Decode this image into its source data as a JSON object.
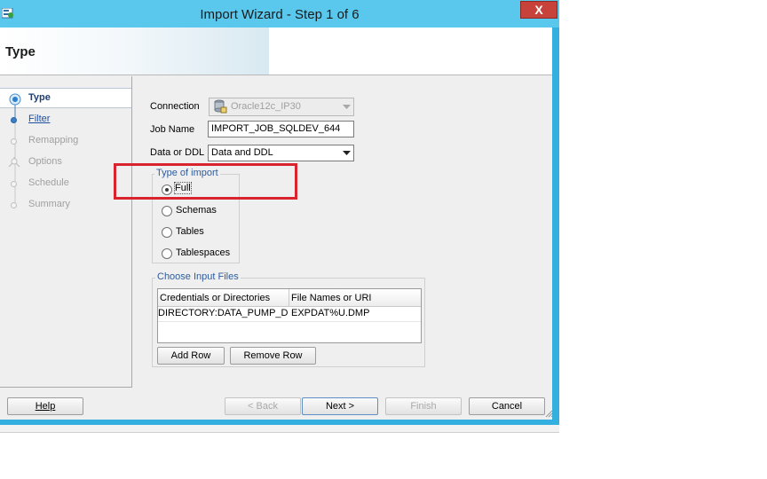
{
  "window": {
    "title": "Import Wizard - Step 1 of 6",
    "close_glyph": "X"
  },
  "page": {
    "title": "Type"
  },
  "nav": [
    {
      "label": "Type"
    },
    {
      "label": "Filter"
    },
    {
      "label": "Remapping"
    },
    {
      "label": "Options"
    },
    {
      "label": "Schedule"
    },
    {
      "label": "Summary"
    }
  ],
  "form": {
    "connection_label": "Connection",
    "connection_value": "Oracle12c_IP30",
    "jobname_label": "Job Name",
    "jobname_value": "IMPORT_JOB_SQLDEV_644",
    "dataddl_label": "Data or DDL",
    "dataddl_value": "Data and DDL"
  },
  "import_type": {
    "legend": "Type of import",
    "options": [
      "Full",
      "Schemas",
      "Tables",
      "Tablespaces"
    ],
    "selected": "Full"
  },
  "input_files": {
    "legend": "Choose Input Files",
    "columns": [
      "Credentials or Directories",
      "File Names or URI"
    ],
    "rows": [
      [
        "DIRECTORY:DATA_PUMP_DIR",
        "EXPDAT%U.DMP"
      ]
    ],
    "add_row": "Add Row",
    "remove_row": "Remove Row"
  },
  "footer": {
    "help": "Help",
    "back": "< Back",
    "next": "Next >",
    "finish": "Finish",
    "cancel": "Cancel"
  },
  "colors": {
    "titlebar": "#5ac8ed",
    "highlight_box": "#d9242f",
    "link": "#1d4f9e"
  }
}
